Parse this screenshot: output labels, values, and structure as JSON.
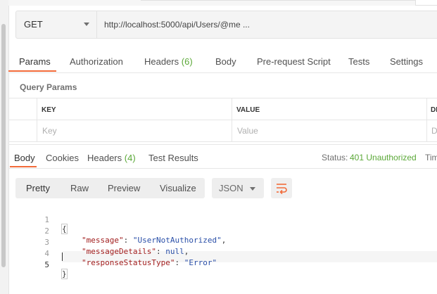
{
  "request": {
    "method": "GET",
    "url": "http://localhost:5000/api/Users/@me ..."
  },
  "request_tabs": [
    {
      "label": "Params",
      "count": ""
    },
    {
      "label": "Authorization",
      "count": ""
    },
    {
      "label": "Headers",
      "count": "(6)"
    },
    {
      "label": "Body",
      "count": ""
    },
    {
      "label": "Pre-request Script",
      "count": ""
    },
    {
      "label": "Tests",
      "count": ""
    },
    {
      "label": "Settings",
      "count": ""
    }
  ],
  "query_params": {
    "title": "Query Params",
    "columns": [
      "KEY",
      "VALUE",
      "DE"
    ],
    "placeholders": [
      "Key",
      "Value",
      "D"
    ]
  },
  "response": {
    "tabs": [
      {
        "label": "Body",
        "count": ""
      },
      {
        "label": "Cookies",
        "count": ""
      },
      {
        "label": "Headers",
        "count": "(4)"
      },
      {
        "label": "Test Results",
        "count": ""
      }
    ],
    "status_label": "Status:",
    "status_value": "401 Unauthorized",
    "time_label": "Tim",
    "view_modes": [
      "Pretty",
      "Raw",
      "Preview",
      "Visualize"
    ],
    "format": "JSON",
    "wrap_icon": "wrap-lines-icon",
    "body_lines": [
      {
        "num": "1",
        "text": "{"
      },
      {
        "num": "2",
        "key": "\"message\"",
        "value": "\"UserNotAuthorized\"",
        "trail": ","
      },
      {
        "num": "3",
        "key": "\"messageDetails\"",
        "value": "null",
        "trail": ","
      },
      {
        "num": "4",
        "key": "\"responseStatusType\"",
        "value": "\"Error\"",
        "trail": ""
      },
      {
        "num": "5",
        "text": "}"
      }
    ]
  },
  "colors": {
    "accent": "#f26b3a",
    "success": "#5ba838",
    "json_key": "#a11d1d",
    "json_value": "#2a4fa8"
  }
}
